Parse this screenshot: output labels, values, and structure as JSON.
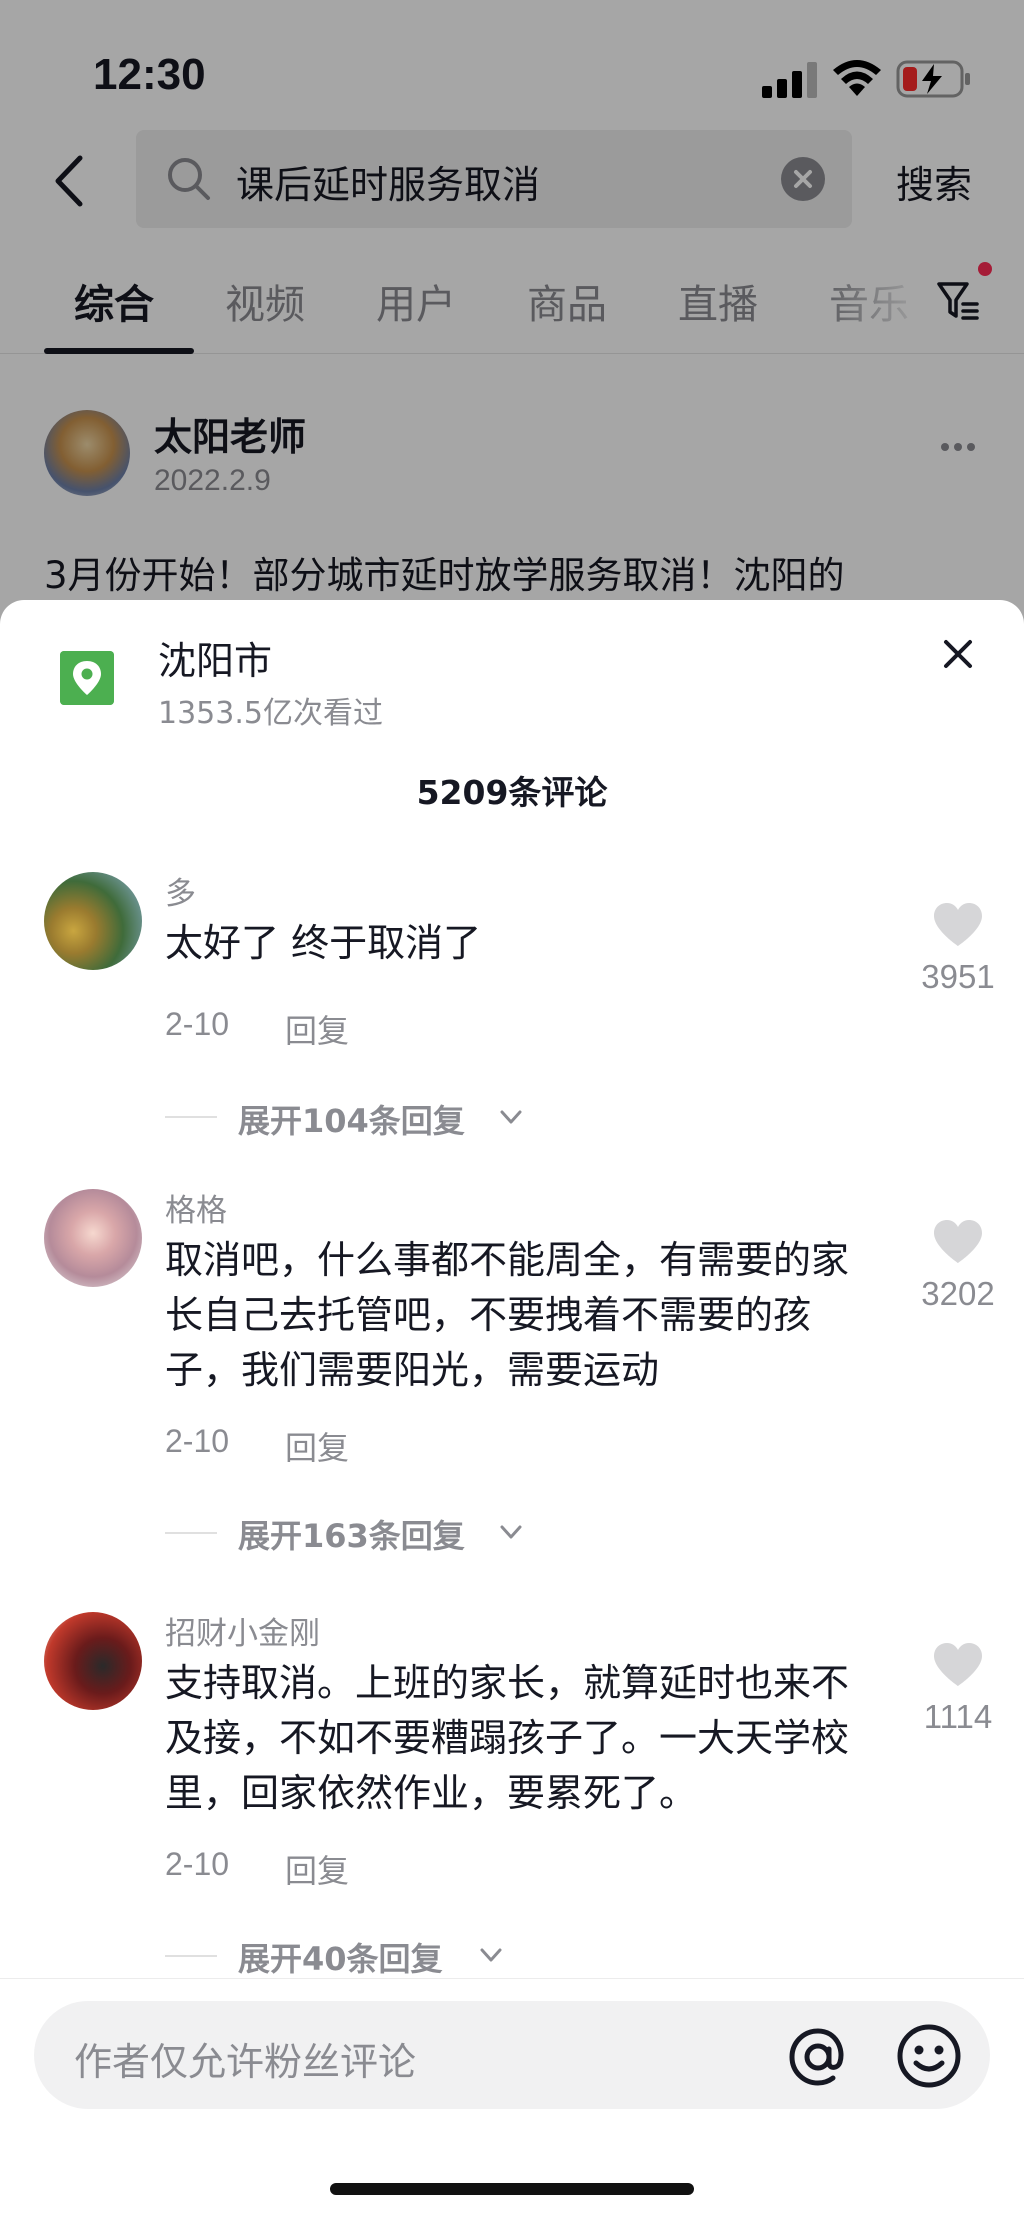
{
  "status_bar": {
    "time": "12:30"
  },
  "search": {
    "query": "课后延时服务取消",
    "submit_label": "搜索"
  },
  "tabs": [
    {
      "label": "综合"
    },
    {
      "label": "视频"
    },
    {
      "label": "用户"
    },
    {
      "label": "商品"
    },
    {
      "label": "直播"
    },
    {
      "label": "音乐"
    }
  ],
  "post": {
    "author": "太阳老师",
    "date": "2022.2.9",
    "text": "3月份开始！部分城市延时放学服务取消！沈阳的"
  },
  "location": {
    "name": "沈阳市",
    "views": "1353.5亿次看过"
  },
  "comment_count": "5209条评论",
  "comments": [
    {
      "name": "多",
      "text": "太好了 终于取消了",
      "date": "2-10",
      "reply_label": "回复",
      "likes": "3951",
      "expand_label": "展开104条回复"
    },
    {
      "name": "格格",
      "text": "取消吧，什么事都不能周全，有需要的家长自己去托管吧，不要拽着不需要的孩子，我们需要阳光，需要运动",
      "date": "2-10",
      "reply_label": "回复",
      "likes": "3202",
      "expand_label": "展开163条回复"
    },
    {
      "name": "招财小金刚",
      "text": "支持取消。上班的家长，就算延时也来不及接，不如不要糟蹋孩子了。一大天学校里，回家依然作业，要累死了。",
      "date": "2-10",
      "reply_label": "回复",
      "likes": "1114",
      "expand_label": "展开40条回复"
    }
  ],
  "input": {
    "placeholder": "作者仅允许粉丝评论"
  },
  "colors": {
    "accent": "#fe2c55",
    "location_icon": "#4caf50",
    "secondary_text": "#8a8b91"
  }
}
